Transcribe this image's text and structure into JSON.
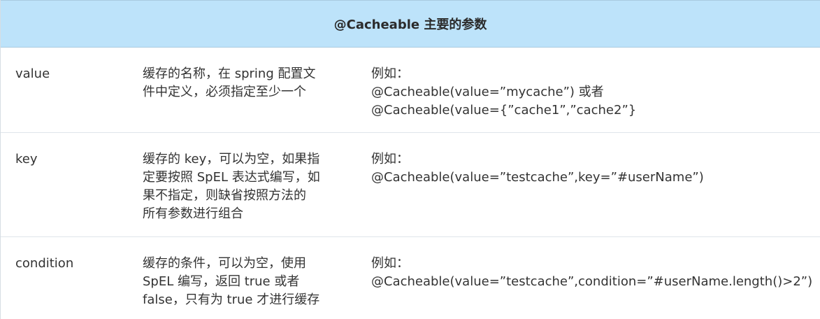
{
  "header": {
    "title": "@Cacheable 主要的参数"
  },
  "rows": [
    {
      "name": "value",
      "description": "缓存的名称，在 spring 配置文\n件中定义，必须指定至少一个",
      "example_lines": [
        "例如：",
        "@Cacheable(value=”mycache”) 或者",
        "@Cacheable(value={”cache1”,”cache2”}"
      ]
    },
    {
      "name": "key",
      "description": "缓存的 key，可以为空，如果指\n定要按照 SpEL 表达式编写，如\n果不指定，则缺省按照方法的\n所有参数进行组合",
      "example_lines": [
        "例如：",
        "@Cacheable(value=”testcache”,key=”#userName”)"
      ]
    },
    {
      "name": "condition",
      "description": "缓存的条件，可以为空，使用\nSpEL 编写，返回 true 或者\nfalse，只有为 true 才进行缓存",
      "example_lines": [
        "例如：",
        "@Cacheable(value=”testcache”,condition=”#userName.length()>2”)"
      ]
    }
  ]
}
